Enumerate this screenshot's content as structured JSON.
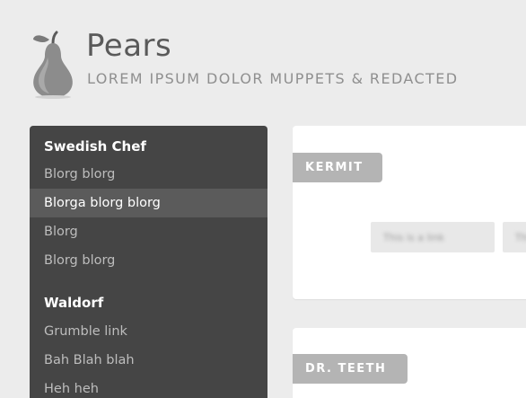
{
  "header": {
    "title": "Pears",
    "subtitle": "LOREM IPSUM DOLOR MUPPETS & REDACTED",
    "logo_icon": "pear-icon"
  },
  "sidebar": {
    "groups": [
      {
        "title": "Swedish Chef",
        "items": [
          {
            "label": "Blorg blorg",
            "active": false
          },
          {
            "label": "Blorga blorg blorg",
            "active": true
          },
          {
            "label": "Blorg",
            "active": false
          },
          {
            "label": "Blorg blorg",
            "active": false
          }
        ]
      },
      {
        "title": "Waldorf",
        "items": [
          {
            "label": "Grumble link",
            "active": false
          },
          {
            "label": "Bah Blah blah",
            "active": false
          },
          {
            "label": "Heh heh",
            "active": false
          }
        ]
      }
    ]
  },
  "cards": [
    {
      "tag": "KERMIT",
      "buttons": [
        {
          "label": "This is a link"
        },
        {
          "label": "This"
        }
      ]
    },
    {
      "tag": "DR. TEETH"
    }
  ],
  "colors": {
    "background": "#ececec",
    "sidebar": "#454545",
    "sidebar_active": "#5b5b5b",
    "tag": "#b4b4b4",
    "title": "#5a5a5a",
    "subtitle": "#8f8f8f"
  }
}
